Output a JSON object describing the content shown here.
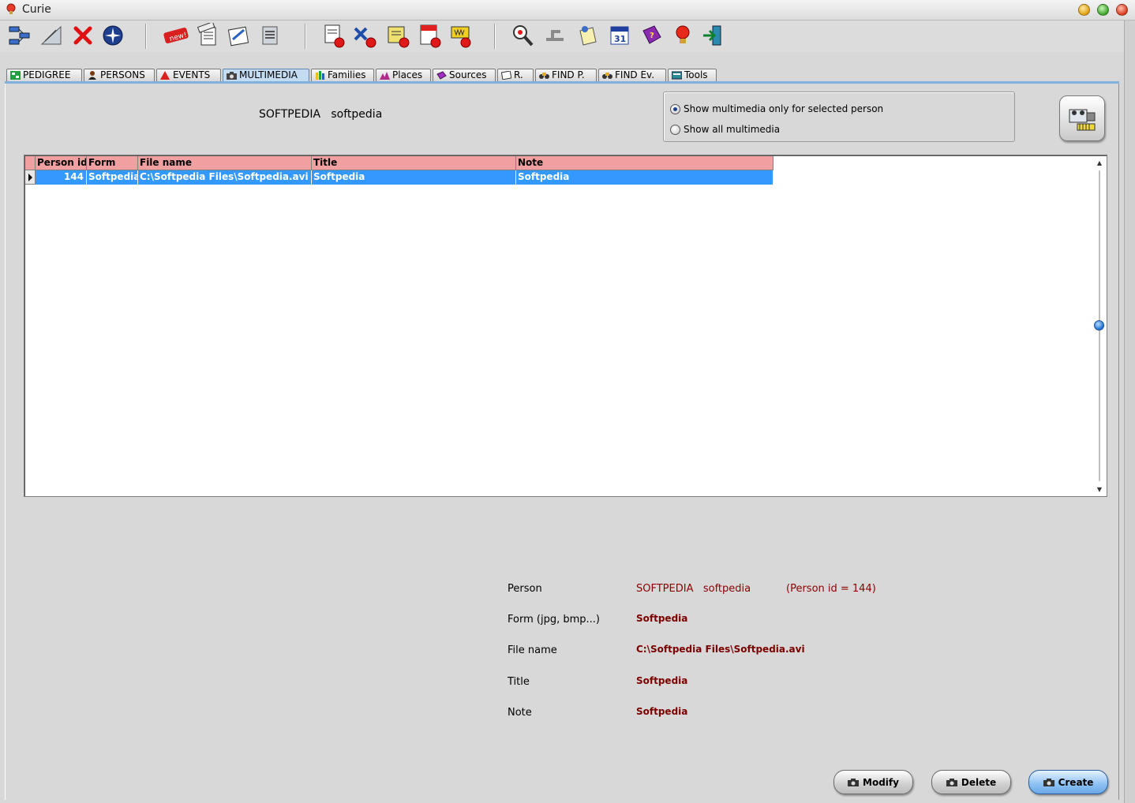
{
  "window": {
    "title": "Curie"
  },
  "toolbar": {
    "icons": [
      "tree-icon",
      "measure-icon",
      "delete-icon",
      "compass-icon",
      "new-icon",
      "gedcom-export-icon",
      "edit-chart-icon",
      "report-icon",
      "gedcom-import-icon",
      "x-export-icon",
      "print-icon",
      "pdf-icon",
      "www-icon",
      "search-icon",
      "branch-icon",
      "notes-icon",
      "calendar-icon",
      "help-book-icon",
      "tip-icon",
      "exit-icon"
    ],
    "calendar_day": "31",
    "new_badge": "new!"
  },
  "tabs": [
    {
      "label": "PEDIGREE",
      "icon": "pedigree-icon"
    },
    {
      "label": "PERSONS",
      "icon": "person-icon"
    },
    {
      "label": "EVENTS",
      "icon": "event-icon"
    },
    {
      "label": "MULTIMEDIA",
      "icon": "camera-icon",
      "active": true
    },
    {
      "label": "Families",
      "icon": "family-icon"
    },
    {
      "label": "Places",
      "icon": "place-icon"
    },
    {
      "label": "Sources",
      "icon": "source-icon"
    },
    {
      "label": "R.",
      "icon": "report-tab-icon"
    },
    {
      "label": "FIND P.",
      "icon": "binoculars-icon"
    },
    {
      "label": "FIND Ev.",
      "icon": "binoculars-icon"
    },
    {
      "label": "Tools",
      "icon": "tools-icon"
    }
  ],
  "header": {
    "person_name": "SOFTPEDIA   softpedia"
  },
  "filter": {
    "option_selected": "Show multimedia only for selected person",
    "option_all": "Show all multimedia"
  },
  "grid": {
    "columns": [
      "Person id",
      "Form",
      "File name",
      "Title",
      "Note"
    ],
    "rows": [
      {
        "person_id": "144",
        "form": "Softpedia",
        "file_name": "C:\\Softpedia Files\\Softpedia.avi",
        "title": "Softpedia",
        "note": "Softpedia"
      }
    ]
  },
  "detail": {
    "person_label": "Person",
    "person_value": "SOFTPEDIA   softpedia",
    "person_id_text": "(Person id = 144)",
    "form_label": "Form (jpg, bmp...)",
    "form_value": "Softpedia",
    "file_label": "File name",
    "file_value": "C:\\Softpedia Files\\Softpedia.avi",
    "title_label": "Title",
    "title_value": "Softpedia",
    "note_label": "Note",
    "note_value": "Softpedia"
  },
  "buttons": {
    "modify": "Modify",
    "delete": "Delete",
    "create": "Create"
  },
  "colors": {
    "grid_header": "#f0a0a0",
    "selection": "#3399ff",
    "detail_value": "#8b0000",
    "active_tab": "#c4dcf2"
  }
}
